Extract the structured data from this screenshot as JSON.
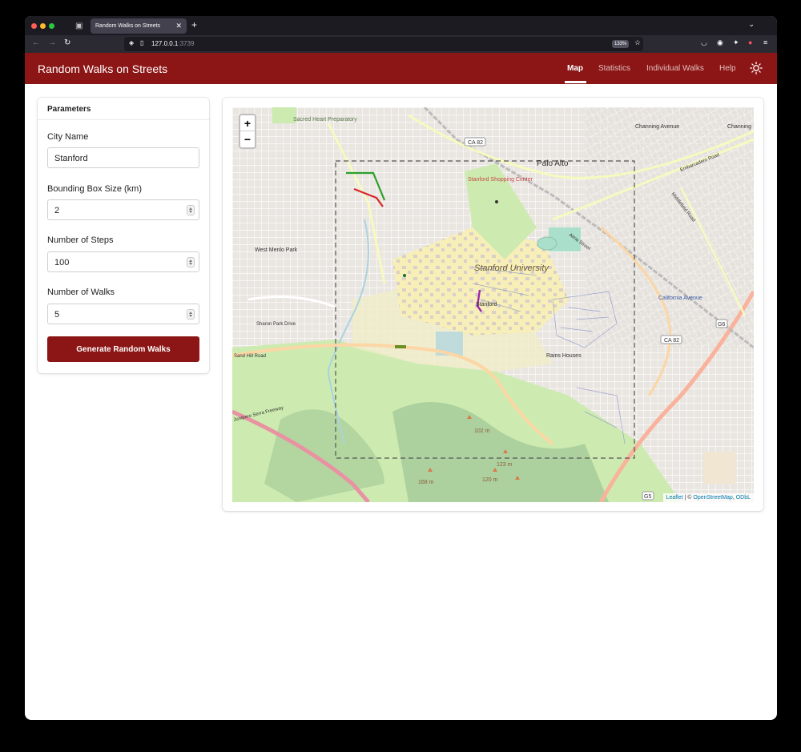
{
  "browser": {
    "tab_title": "Random Walks on Streets",
    "url_host": "127.0.0.1",
    "url_port": ":3739",
    "zoom_level": "133%"
  },
  "app": {
    "title": "Random Walks on Streets",
    "nav": [
      {
        "label": "Map",
        "active": true
      },
      {
        "label": "Statistics",
        "active": false
      },
      {
        "label": "Individual Walks",
        "active": false
      },
      {
        "label": "Help",
        "active": false
      }
    ],
    "theme_icon": "sun-icon"
  },
  "params": {
    "heading": "Parameters",
    "city_label": "City Name",
    "city_value": "Stanford",
    "bbox_label": "Bounding Box Size (km)",
    "bbox_value": "2",
    "steps_label": "Number of Steps",
    "steps_value": "100",
    "walks_label": "Number of Walks",
    "walks_value": "5",
    "generate_label": "Generate Random Walks"
  },
  "map": {
    "zoom_in": "+",
    "zoom_out": "−",
    "attribution_leaflet": "Leaflet",
    "attribution_sep": " | © ",
    "attribution_osm": "OpenStreetMap",
    "attribution_odbl": "ODbL",
    "labels": {
      "palo_alto": "Palo Alto",
      "stanford_university": "Stanford University",
      "stanford_shopping": "Stanford Shopping Center",
      "west_menlo": "West Menlo Park",
      "california_ave": "California Avenue",
      "channing": "Channing Avenue",
      "channing2": "Channing",
      "sacred_heart": "Sacred Heart Preparatory",
      "rains_houses": "Rains Houses",
      "elev_102": "102 m",
      "elev_123": "123 m",
      "elev_120": "120 m",
      "elev_168": "168 m",
      "ca82_top": "CA 82",
      "ca82_right": "CA 82",
      "g6": "G6",
      "g5": "G5",
      "sand_hill": "Sand Hill Road",
      "junipero": "Junipero Serra Freeway",
      "embarcadero": "Embarcadero Road",
      "middlefield": "Middlefield Road",
      "alma": "Alma Street",
      "sharon": "Sharon Park Drive",
      "stanford_oval": "Stanford"
    },
    "colors": {
      "walk_green": "#2ca02c",
      "walk_red": "#d62728",
      "walk_purple": "#9b27b0"
    }
  }
}
